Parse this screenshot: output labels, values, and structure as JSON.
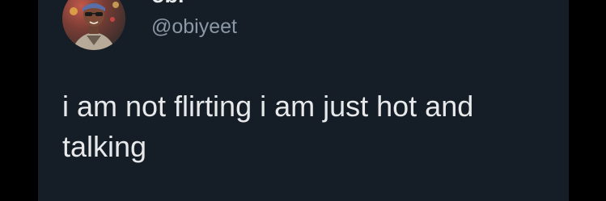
{
  "tweet": {
    "author": {
      "display_name": "obi",
      "handle": "@obiyeet"
    },
    "text": "i am not flirting i am just hot and talking"
  },
  "colors": {
    "background": "#000000",
    "card": "#151d27",
    "text_primary": "#e7e9ea",
    "text_secondary": "#8b98a5"
  }
}
